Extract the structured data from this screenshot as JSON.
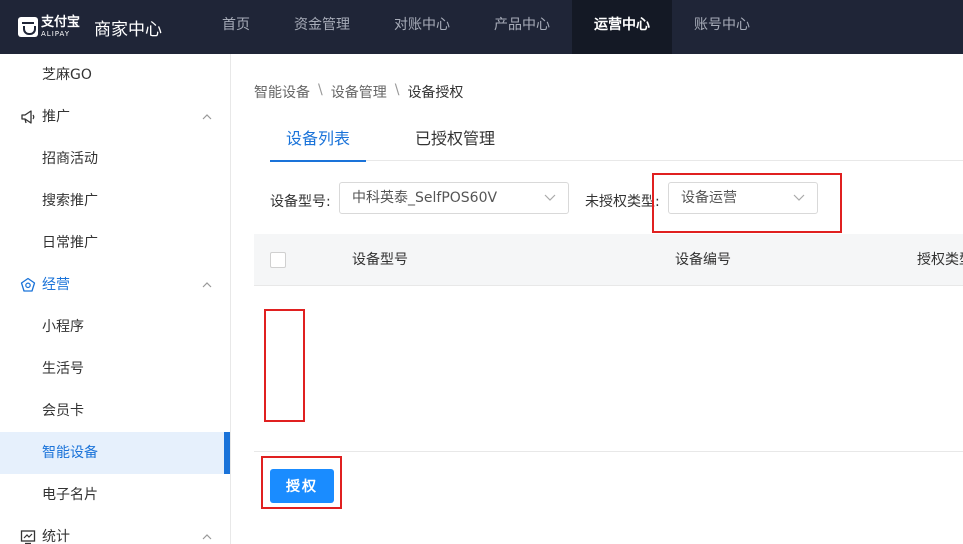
{
  "brand": {
    "logo_cn": "支付宝",
    "logo_en": "ALIPAY",
    "title": "商家中心"
  },
  "nav": [
    {
      "label": "首页",
      "active": false
    },
    {
      "label": "资金管理",
      "active": false
    },
    {
      "label": "对账中心",
      "active": false
    },
    {
      "label": "产品中心",
      "active": false
    },
    {
      "label": "运营中心",
      "active": true
    },
    {
      "label": "账号中心",
      "active": false
    }
  ],
  "sidebar": {
    "item_zhima": "芝麻GO",
    "group_promo": "推广",
    "item_zhaoshang": "招商活动",
    "item_sousuo": "搜索推广",
    "item_richang": "日常推广",
    "group_operate": "经营",
    "item_miniapp": "小程序",
    "item_life": "生活号",
    "item_member": "会员卡",
    "item_device": "智能设备",
    "item_card": "电子名片",
    "group_stats": "统计"
  },
  "breadcrumb": [
    "智能设备",
    "设备管理",
    "设备授权"
  ],
  "breadcrumb_sep": "\\",
  "tabs": {
    "list": "设备列表",
    "authorized": "已授权管理"
  },
  "filters": {
    "model_label": "设备型号:",
    "model_value": "中科英泰_SelfPOS60V",
    "type_label": "未授权类型:",
    "type_value": "设备运营"
  },
  "table": {
    "col_model": "设备型号",
    "col_serial": "设备编号",
    "col_authtype": "授权类型"
  },
  "actions": {
    "authorize": "授权"
  },
  "colors": {
    "topbar": "#1f2537",
    "accent": "#1a73d9",
    "primary_button": "#1a8cff",
    "highlight": "#e02020"
  }
}
